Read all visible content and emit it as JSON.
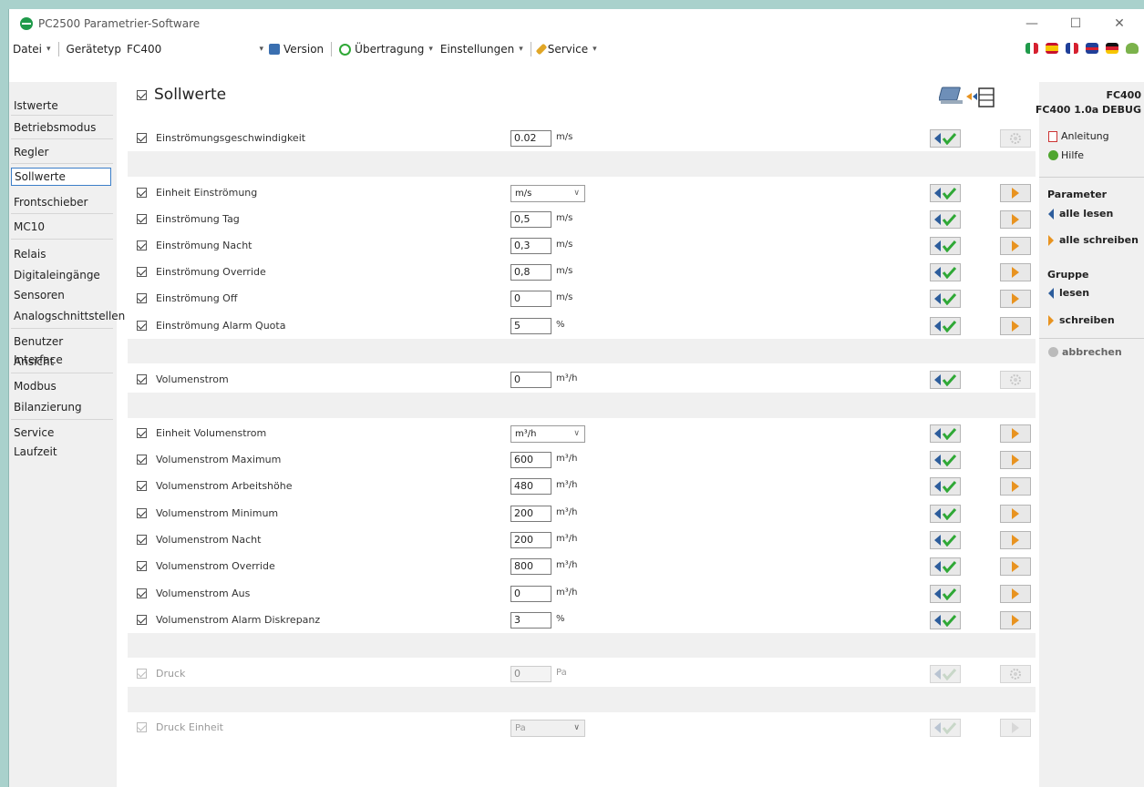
{
  "window": {
    "title": "PC2500 Parametrier-Software"
  },
  "menu": {
    "datei": "Datei",
    "geraetetyp_label": "Gerätetyp",
    "geraetetyp_value": "FC400",
    "version": "Version",
    "uebertragung": "Übertragung",
    "einstellungen": "Einstellungen",
    "service": "Service"
  },
  "flags": [
    "italian-flag-icon",
    "spanish-flag-icon",
    "french-flag-icon",
    "uk-flag-icon",
    "german-flag-icon",
    "language-icon"
  ],
  "sidebar": {
    "items": [
      {
        "label": "Istwerte"
      },
      {
        "label": "Betriebsmodus"
      },
      {
        "label": "Regler"
      },
      {
        "label": "Sollwerte",
        "active": true
      },
      {
        "label": "Frontschieber"
      },
      {
        "label": "MC10"
      },
      {
        "label": "Relais"
      },
      {
        "label": "Digitaleingänge"
      },
      {
        "label": "Sensoren"
      },
      {
        "label": "Analogschnittstellen"
      },
      {
        "label": "Benutzer Interface"
      },
      {
        "label": "Ansicht"
      },
      {
        "label": "Modbus"
      },
      {
        "label": "Bilanzierung"
      },
      {
        "label": "Service"
      },
      {
        "label": "Laufzeit"
      }
    ]
  },
  "page": {
    "title": "Sollwerte"
  },
  "rows": [
    {
      "label": "Einströmungsgeschwindigkeit",
      "value": "0.02",
      "unit": "m/s",
      "kind": "input",
      "write": "gear"
    },
    {
      "label": "Einheit Einströmung",
      "value": "m/s",
      "kind": "select",
      "write": "arrow"
    },
    {
      "label": "Einströmung Tag",
      "value": "0,5",
      "unit": "m/s",
      "kind": "input",
      "write": "arrow"
    },
    {
      "label": "Einströmung Nacht",
      "value": "0,3",
      "unit": "m/s",
      "kind": "input",
      "write": "arrow"
    },
    {
      "label": "Einströmung Override",
      "value": "0,8",
      "unit": "m/s",
      "kind": "input",
      "write": "arrow"
    },
    {
      "label": "Einströmung Off",
      "value": "0",
      "unit": "m/s",
      "kind": "input",
      "write": "arrow"
    },
    {
      "label": "Einströmung Alarm Quota",
      "value": "5",
      "unit": "%",
      "kind": "input",
      "write": "arrow"
    },
    {
      "label": "Volumenstrom",
      "value": "0",
      "unit": "m³/h",
      "kind": "input",
      "write": "gear"
    },
    {
      "label": "Einheit Volumenstrom",
      "value": "m³/h",
      "kind": "select",
      "write": "arrow"
    },
    {
      "label": "Volumenstrom Maximum",
      "value": "600",
      "unit": "m³/h",
      "kind": "input",
      "write": "arrow"
    },
    {
      "label": "Volumenstrom Arbeitshöhe",
      "value": "480",
      "unit": "m³/h",
      "kind": "input",
      "write": "arrow"
    },
    {
      "label": "Volumenstrom Minimum",
      "value": "200",
      "unit": "m³/h",
      "kind": "input",
      "write": "arrow"
    },
    {
      "label": "Volumenstrom Nacht",
      "value": "200",
      "unit": "m³/h",
      "kind": "input",
      "write": "arrow"
    },
    {
      "label": "Volumenstrom Override",
      "value": "800",
      "unit": "m³/h",
      "kind": "input",
      "write": "arrow"
    },
    {
      "label": "Volumenstrom Aus",
      "value": "0",
      "unit": "m³/h",
      "kind": "input",
      "write": "arrow"
    },
    {
      "label": "Volumenstrom Alarm Diskrepanz",
      "value": "3",
      "unit": "%",
      "kind": "input",
      "write": "arrow"
    },
    {
      "label": "Druck",
      "value": "0",
      "unit": "Pa",
      "kind": "input",
      "write": "gear",
      "disabled": true
    },
    {
      "label": "Druck Einheit",
      "value": "Pa",
      "kind": "select",
      "write": "arrow",
      "disabled": true
    }
  ],
  "right_panel": {
    "device": "FC400",
    "firmware": "FC400 1.0a DEBUG",
    "anleitung": "Anleitung",
    "hilfe": "Hilfe",
    "parameter_header": "Parameter",
    "alle_lesen": "alle lesen",
    "alle_schreiben": "alle schreiben",
    "gruppe_header": "Gruppe",
    "lesen": "lesen",
    "schreiben": "schreiben",
    "abbrechen": "abbrechen"
  },
  "colors": {
    "background": "#a9d1cc",
    "accent_blue": "#2d5d9c",
    "accent_green": "#2fa836",
    "accent_orange": "#e89320"
  }
}
